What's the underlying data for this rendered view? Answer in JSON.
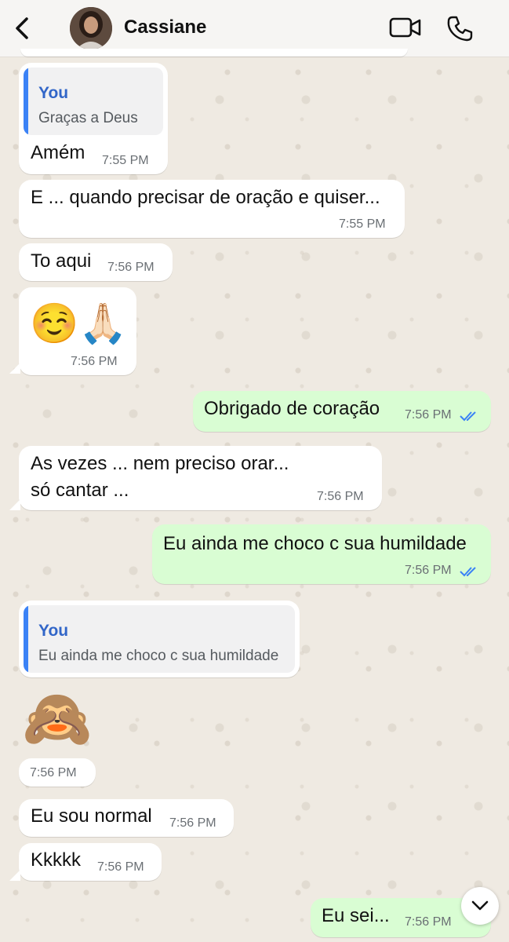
{
  "header": {
    "contact_name": "Cassiane",
    "icons": {
      "back": "chevron-left-icon",
      "video_call": "video-camera-icon",
      "voice_call": "phone-icon"
    }
  },
  "messages": [
    {
      "direction": "in",
      "quote_author": "You",
      "quote_text": "Graças a Deus",
      "text": "Amém",
      "time": "7:55 PM"
    },
    {
      "direction": "in",
      "text": "E ... quando precisar de oração e quiser...",
      "time": "7:55 PM"
    },
    {
      "direction": "in",
      "text": "To aqui",
      "time": "7:56 PM"
    },
    {
      "direction": "in",
      "text": "☺️🙏🏻",
      "time": "7:56 PM"
    },
    {
      "direction": "out",
      "text": "Obrigado de coração",
      "time": "7:56 PM",
      "status": "read"
    },
    {
      "direction": "in",
      "text_line1": "As vezes ... nem preciso orar...",
      "text_line2": "só cantar ...",
      "time": "7:56 PM"
    },
    {
      "direction": "out",
      "text": "Eu ainda me choco c sua humildade",
      "time": "7:56 PM",
      "status": "read"
    },
    {
      "direction": "in",
      "quote_author": "You",
      "quote_text": "Eu ainda me choco c sua humildade"
    },
    {
      "direction": "in",
      "text": "🙈",
      "time": "7:56 PM"
    },
    {
      "direction": "in",
      "text": "Eu sou normal",
      "time": "7:56 PM"
    },
    {
      "direction": "in",
      "text": "Kkkkk",
      "time": "7:56 PM"
    },
    {
      "direction": "out",
      "text": "Eu sei...",
      "time": "7:56 PM",
      "status": "read"
    }
  ],
  "colors": {
    "incoming_bubble": "#ffffff",
    "outgoing_bubble": "#d9fdd3",
    "read_ticks": "#3b82f6",
    "quote_author": "#3266c8",
    "chat_background": "#efeae2"
  }
}
